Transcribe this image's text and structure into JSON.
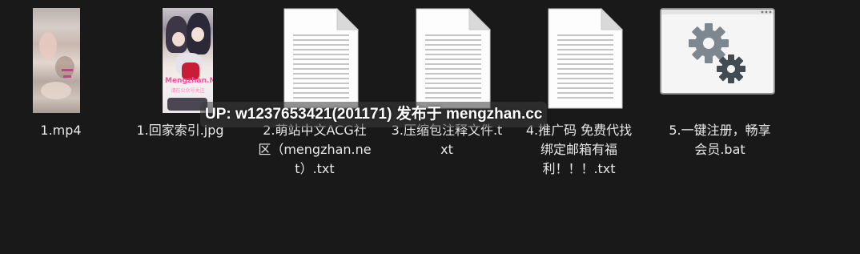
{
  "files": [
    {
      "name": "1.mp4",
      "kind": "video",
      "icon": "video-thumbnail"
    },
    {
      "name": "1.回家索引.jpg",
      "kind": "image",
      "icon": "image-thumbnail",
      "thumbnail_text": "Mengzhan.Net",
      "thumbnail_subtext": "请在公众号关注"
    },
    {
      "name": "2.萌站中文ACG社区（mengzhan.net）.txt",
      "kind": "text",
      "icon": "text-document-icon"
    },
    {
      "name": "3.压缩包注释文件.txt",
      "kind": "text",
      "icon": "text-document-icon"
    },
    {
      "name": "4.推广码 免费代找 绑定邮箱有福利！！！.txt",
      "kind": "text",
      "icon": "text-document-icon"
    },
    {
      "name": "5.一键注册，畅享会员.bat",
      "kind": "batch",
      "icon": "batch-file-gear-icon"
    }
  ],
  "watermark": "UP: w1237653421(201171) 发布于 mengzhan.cc",
  "colors": {
    "background": "#191919",
    "label_text": "#e9e9e9",
    "gear": "#7d8790"
  }
}
